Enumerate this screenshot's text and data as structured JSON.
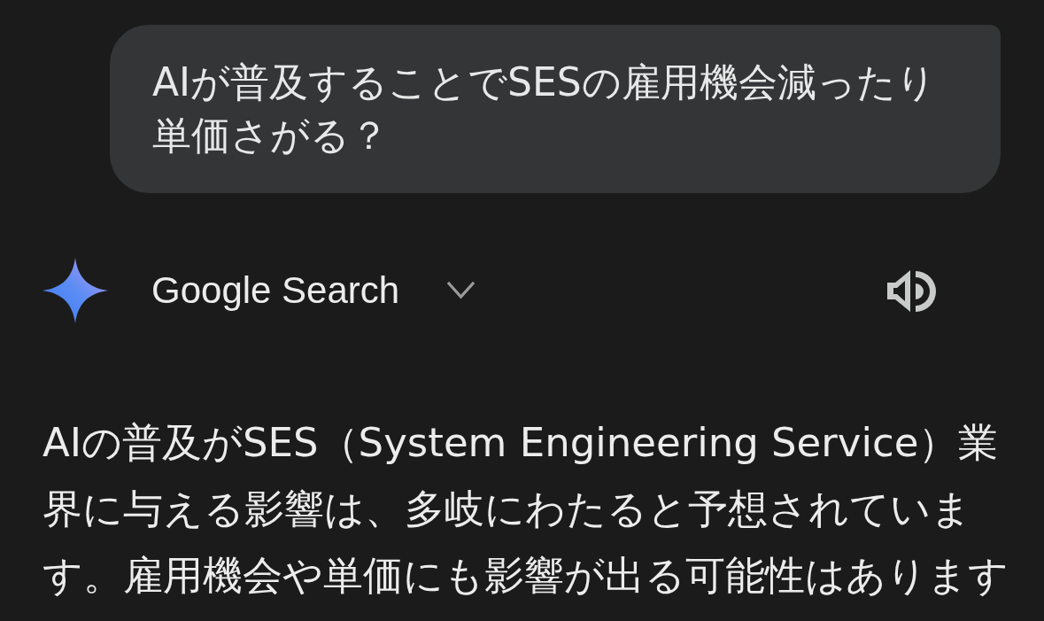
{
  "user_message": {
    "text": "AIが普及することでSESの雇用機会減ったり単価さがる？"
  },
  "response": {
    "source": {
      "label": "Google Search",
      "expanded": false
    },
    "text": "AIの普及がSES（System Engineering Service）業界に与える影響は、多岐にわたると予想されています。雇用機会や単価にも影響が出る可能性はあります"
  }
}
